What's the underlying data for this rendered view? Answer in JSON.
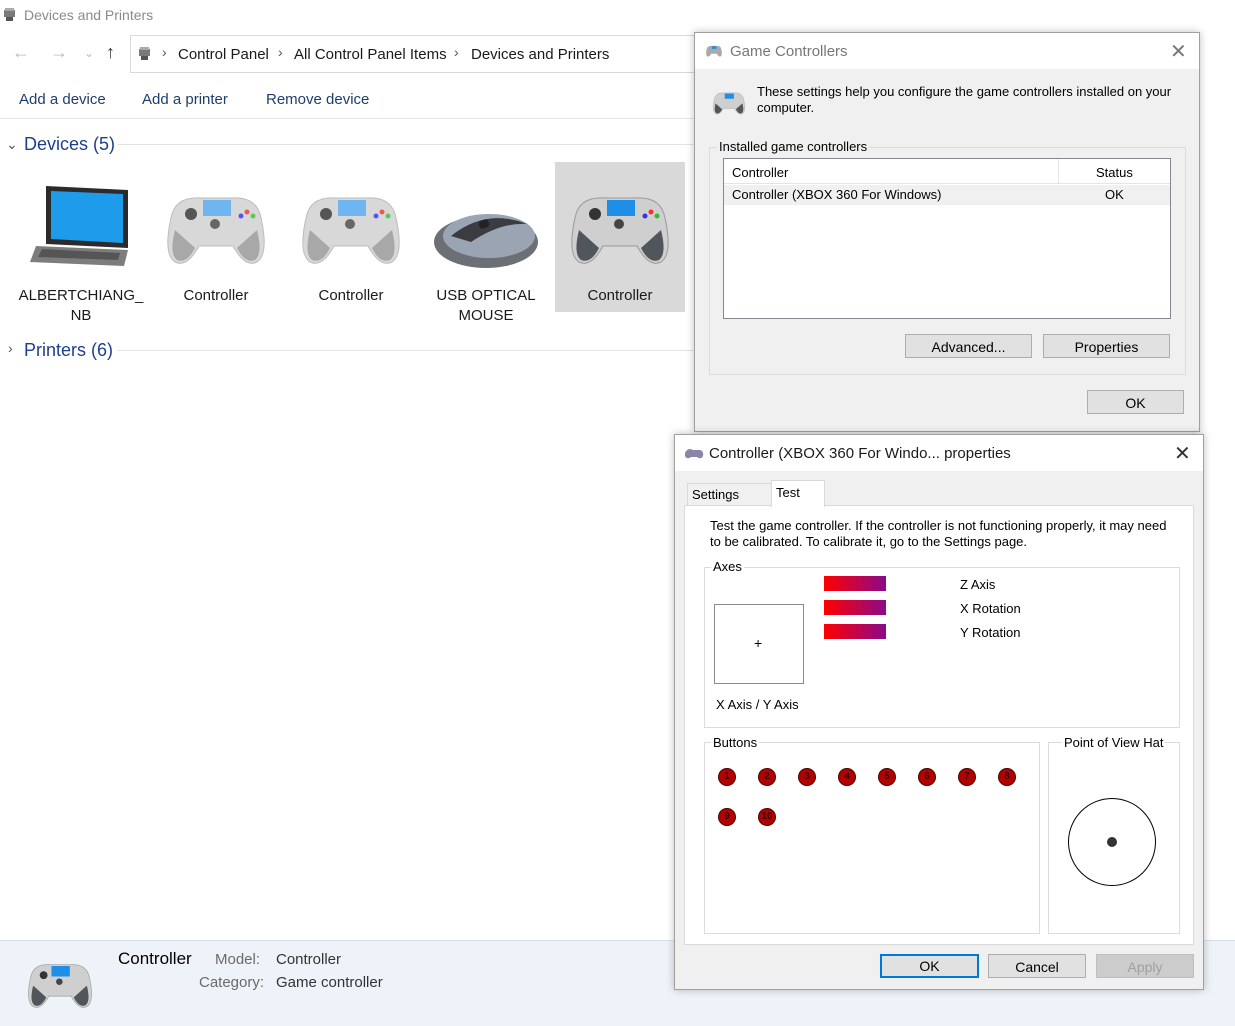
{
  "explorer": {
    "title": "Devices and Printers",
    "breadcrumb": [
      "Control Panel",
      "All Control Panel Items",
      "Devices and Printers"
    ],
    "commands": [
      "Add a device",
      "Add a printer",
      "Remove device"
    ],
    "devices_header": "Devices (5)",
    "printers_header": "Printers (6)",
    "devices": [
      {
        "label": "ALBERTCHIANG_\nNB",
        "icon": "laptop-icon"
      },
      {
        "label": "Controller",
        "icon": "gamepad-icon"
      },
      {
        "label": "Controller",
        "icon": "gamepad-icon"
      },
      {
        "label": "USB OPTICAL\nMOUSE",
        "icon": "mouse-icon"
      },
      {
        "label": "Controller",
        "icon": "gamepad-icon"
      }
    ],
    "details": {
      "name": "Controller",
      "model_label": "Model:",
      "model_value": "Controller",
      "category_label": "Category:",
      "category_value": "Game controller"
    }
  },
  "game_controllers": {
    "title": "Game Controllers",
    "description": "These settings help you configure the game controllers installed on your computer.",
    "group_label": "Installed game controllers",
    "columns": [
      "Controller",
      "Status"
    ],
    "rows": [
      [
        "Controller (XBOX 360 For Windows)",
        "OK"
      ]
    ],
    "advanced_label": "Advanced...",
    "properties_label": "Properties",
    "ok_label": "OK"
  },
  "properties": {
    "title": "Controller (XBOX 360 For Windo... properties",
    "tabs": [
      "Settings",
      "Test"
    ],
    "active_tab": "Test",
    "description": "Test the game controller.  If the controller is not functioning properly, it may need to be calibrated.  To calibrate it, go to the Settings page.",
    "axes_label": "Axes",
    "xy_label": "X Axis / Y Axis",
    "axis_rows": [
      "Z Axis",
      "X Rotation",
      "Y Rotation"
    ],
    "buttons_label": "Buttons",
    "buttons": [
      "1",
      "2",
      "3",
      "4",
      "5",
      "6",
      "7",
      "8",
      "9",
      "10"
    ],
    "pov_label": "Point of View Hat",
    "ok_label": "OK",
    "cancel_label": "Cancel",
    "apply_label": "Apply"
  }
}
